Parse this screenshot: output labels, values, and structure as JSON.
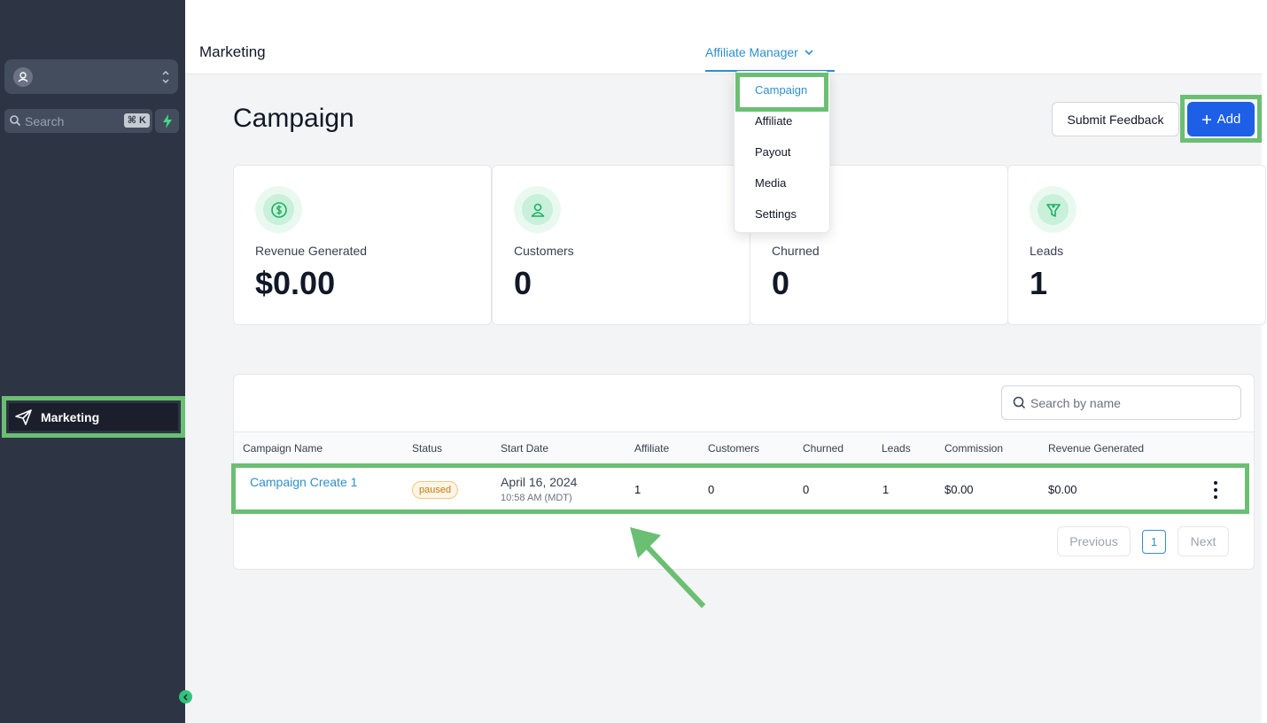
{
  "sidebar": {
    "search_label": "Search",
    "search_shortcut": "⌘ K",
    "nav_items": [
      {
        "label": "Marketing",
        "icon": "send-icon"
      }
    ]
  },
  "topbar": {
    "title": "Marketing",
    "active_tab": "Affiliate Manager"
  },
  "dropdown": {
    "items": [
      "Campaign",
      "Affiliate",
      "Payout",
      "Media",
      "Settings"
    ],
    "selected": "Campaign"
  },
  "page": {
    "title": "Campaign",
    "feedback_button": "Submit Feedback",
    "add_button": "Add"
  },
  "stats": [
    {
      "label": "Revenue Generated",
      "value": "$0.00",
      "icon": "dollar-icon"
    },
    {
      "label": "Customers",
      "value": "0",
      "icon": "user-icon"
    },
    {
      "label": "Churned",
      "value": "0",
      "icon": "churn-icon"
    },
    {
      "label": "Leads",
      "value": "1",
      "icon": "funnel-icon"
    }
  ],
  "table": {
    "search_placeholder": "Search by name",
    "columns": [
      "Campaign Name",
      "Status",
      "Start Date",
      "Affiliate",
      "Customers",
      "Churned",
      "Leads",
      "Commission",
      "Revenue Generated"
    ],
    "rows": [
      {
        "name": "Campaign Create 1",
        "status": "paused",
        "start_date": "April 16, 2024",
        "start_time": "10:58 AM (MDT)",
        "affiliate": "1",
        "customers": "0",
        "churned": "0",
        "leads": "1",
        "commission": "$0.00",
        "revenue": "$0.00"
      }
    ],
    "pagination": {
      "previous": "Previous",
      "page": "1",
      "next": "Next"
    }
  },
  "colors": {
    "sidebar_bg": "#2d3545",
    "accent_blue": "#1d5fe6",
    "link_blue": "#2f8fce",
    "highlight_green": "#6bbf73",
    "stat_green": "#1fae63"
  }
}
